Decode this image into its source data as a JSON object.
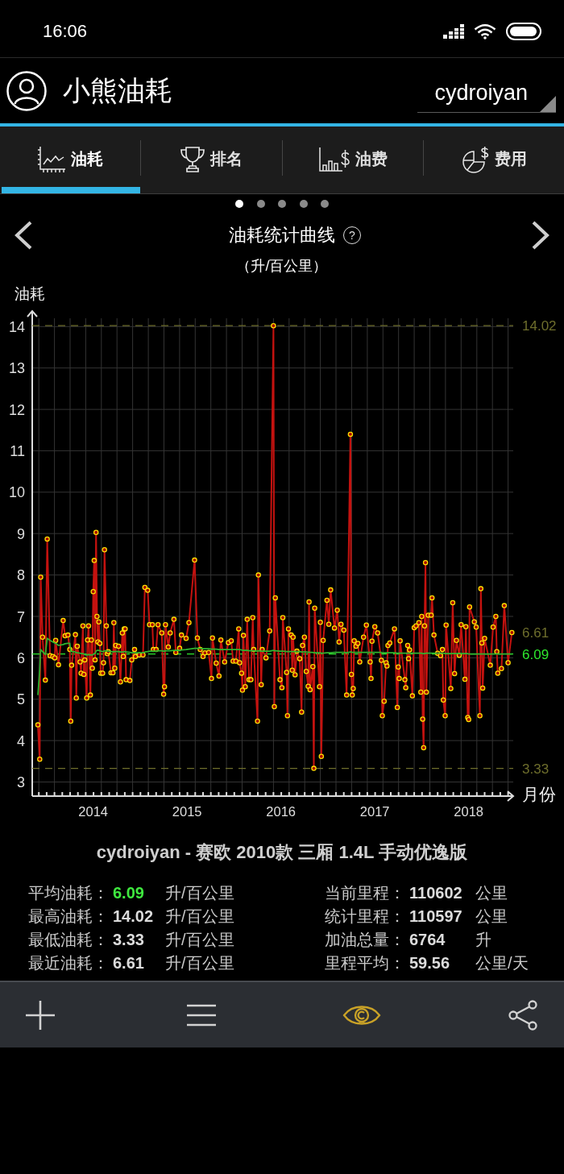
{
  "status_bar": {
    "time": "16:06"
  },
  "app_bar": {
    "title": "小熊油耗",
    "account": "cydroiyan"
  },
  "tabs": [
    {
      "label": "油耗",
      "selected": true
    },
    {
      "label": "排名",
      "selected": false
    },
    {
      "label": "油费",
      "selected": false
    },
    {
      "label": "费用",
      "selected": false
    }
  ],
  "page_dots": [
    {
      "selected": true
    },
    {
      "selected": false
    },
    {
      "selected": false
    },
    {
      "selected": false
    },
    {
      "selected": false
    }
  ],
  "chart_panel": {
    "title": "油耗统计曲线",
    "help": "?",
    "unit": "（升/百公里）",
    "chart_data": {
      "type": "line",
      "xlabel": "月份",
      "ylabel": "油耗",
      "grid": true,
      "xlim": [
        2013.35,
        2018.475
      ],
      "ylim": [
        2.66,
        14.2
      ],
      "xticks": [
        2014,
        2015,
        2016,
        2017,
        2018
      ],
      "yticks": [
        3,
        4,
        5,
        6,
        7,
        8,
        9,
        10,
        11,
        12,
        13,
        14
      ],
      "x": [
        2013.41,
        2013.43,
        2013.44,
        2013.46,
        2013.49,
        2013.51,
        2013.54,
        2013.57,
        2013.59,
        2013.6,
        2013.63,
        2013.68,
        2013.7,
        2013.73,
        2013.75,
        2013.76,
        2013.77,
        2013.81,
        2013.82,
        2013.83,
        2013.86,
        2013.87,
        2013.89,
        2013.9,
        2013.91,
        2013.93,
        2013.94,
        2013.95,
        2013.97,
        2013.98,
        2013.99,
        2014,
        2014.01,
        2014.02,
        2014.03,
        2014.04,
        2014.05,
        2014.06,
        2014.07,
        2014.08,
        2014.1,
        2014.11,
        2014.12,
        2014.14,
        2014.15,
        2014.16,
        2014.19,
        2014.21,
        2014.22,
        2014.23,
        2014.24,
        2014.27,
        2014.29,
        2014.31,
        2014.32,
        2014.33,
        2014.34,
        2014.35,
        2014.39,
        2014.41,
        2014.44,
        2014.45,
        2014.49,
        2014.53,
        2014.55,
        2014.58,
        2014.6,
        2014.63,
        2014.64,
        2014.67,
        2014.69,
        2014.73,
        2014.75,
        2014.76,
        2014.77,
        2014.8,
        2014.82,
        2014.86,
        2014.88,
        2014.92,
        2014.94,
        2014.99,
        2015.02,
        2015.08,
        2015.11,
        2015.14,
        2015.17,
        2015.19,
        2015.23,
        2015.26,
        2015.27,
        2015.31,
        2015.34,
        2015.36,
        2015.4,
        2015.44,
        2015.47,
        2015.49,
        2015.52,
        2015.55,
        2015.56,
        2015.58,
        2015.59,
        2015.6,
        2015.62,
        2015.64,
        2015.66,
        2015.68,
        2015.7,
        2015.71,
        2015.75,
        2015.76,
        2015.79,
        2015.8,
        2015.84,
        2015.88,
        2015.92,
        2015.93,
        2015.94,
        2015.99,
        2016.01,
        2016.02,
        2016.06,
        2016.07,
        2016.08,
        2016.11,
        2016.12,
        2016.13,
        2016.15,
        2016.17,
        2016.2,
        2016.22,
        2016.23,
        2016.25,
        2016.27,
        2016.29,
        2016.3,
        2016.31,
        2016.34,
        2016.35,
        2016.36,
        2016.41,
        2016.42,
        2016.43,
        2016.45,
        2016.49,
        2016.51,
        2016.53,
        2016.57,
        2016.6,
        2016.62,
        2016.64,
        2016.67,
        2016.7,
        2016.74,
        2016.75,
        2016.76,
        2016.77,
        2016.78,
        2016.8,
        2016.82,
        2016.84,
        2016.88,
        2016.91,
        2016.95,
        2016.96,
        2016.97,
        2017,
        2017.03,
        2017.07,
        2017.08,
        2017.1,
        2017.12,
        2017.13,
        2017.14,
        2017.16,
        2017.21,
        2017.24,
        2017.25,
        2017.26,
        2017.27,
        2017.32,
        2017.33,
        2017.35,
        2017.36,
        2017.37,
        2017.4,
        2017.42,
        2017.44,
        2017.47,
        2017.49,
        2017.5,
        2017.51,
        2017.52,
        2017.53,
        2017.54,
        2017.55,
        2017.57,
        2017.6,
        2017.61,
        2017.63,
        2017.67,
        2017.7,
        2017.72,
        2017.73,
        2017.75,
        2017.76,
        2017.81,
        2017.83,
        2017.85,
        2017.87,
        2017.9,
        2017.92,
        2017.96,
        2017.97,
        2017.99,
        2018,
        2018.01,
        2018.06,
        2018.08,
        2018.12,
        2018.13,
        2018.14,
        2018.15,
        2018.17,
        2018.23,
        2018.26,
        2018.29,
        2018.3,
        2018.31,
        2018.35,
        2018.38,
        2018.42,
        2018.46
      ],
      "series": [
        {
          "color": "#c4120f",
          "marker": "o",
          "values": [
            4.38,
            3.55,
            7.95,
            6.5,
            5.46,
            8.87,
            6.05,
            6.03,
            6.0,
            6.42,
            5.83,
            6.9,
            6.53,
            6.55,
            6.2,
            4.47,
            5.82,
            6.56,
            5.03,
            6.28,
            5.9,
            5.63,
            6.77,
            5.6,
            5.95,
            5.03,
            6.43,
            6.77,
            5.1,
            6.43,
            5.75,
            7.6,
            8.35,
            5.95,
            9.03,
            7.0,
            6.38,
            6.87,
            6.35,
            5.63,
            5.63,
            5.88,
            8.61,
            6.77,
            6.1,
            6.15,
            5.64,
            5.64,
            6.85,
            5.75,
            6.3,
            6.28,
            5.42,
            6.6,
            6.03,
            6.7,
            6.7,
            5.47,
            5.45,
            5.95,
            6.2,
            6.03,
            6.07,
            6.07,
            7.7,
            7.63,
            6.8,
            6.8,
            6.2,
            6.2,
            6.8,
            6.6,
            5.12,
            5.3,
            6.8,
            6.26,
            6.6,
            6.93,
            6.13,
            6.23,
            6.55,
            6.47,
            6.85,
            8.36,
            6.48,
            6.2,
            6.03,
            6.12,
            6.13,
            5.5,
            6.48,
            5.87,
            5.56,
            6.43,
            5.9,
            6.37,
            6.41,
            5.92,
            5.92,
            6.7,
            5.88,
            5.63,
            5.22,
            6.54,
            5.3,
            6.93,
            5.47,
            5.47,
            6.97,
            6.2,
            4.47,
            8.0,
            5.35,
            6.2,
            6.0,
            6.65,
            14.02,
            4.82,
            7.45,
            5.47,
            5.28,
            6.97,
            5.65,
            4.6,
            6.7,
            6.55,
            5.7,
            6.5,
            5.59,
            6.16,
            5.98,
            4.69,
            6.3,
            6.5,
            5.67,
            5.31,
            7.35,
            5.23,
            5.79,
            3.33,
            7.2,
            5.3,
            6.86,
            3.62,
            6.42,
            7.39,
            6.81,
            7.64,
            6.72,
            7.15,
            6.38,
            6.81,
            6.67,
            5.1,
            11.4,
            5.6,
            5.1,
            5.26,
            6.41,
            6.28,
            6.35,
            5.9,
            6.5,
            6.79,
            5.9,
            5.5,
            6.4,
            6.75,
            6.6,
            5.94,
            4.6,
            4.95,
            5.88,
            5.8,
            6.3,
            6.36,
            6.7,
            4.8,
            5.78,
            5.5,
            6.41,
            5.47,
            5.28,
            6.3,
            5.98,
            6.19,
            5.08,
            6.73,
            6.77,
            6.85,
            5.17,
            7.0,
            4.52,
            3.83,
            6.77,
            8.3,
            5.17,
            7.03,
            7.03,
            7.45,
            6.55,
            6.11,
            6.05,
            6.2,
            4.98,
            4.6,
            6.79,
            5.26,
            7.33,
            5.62,
            6.42,
            6.06,
            6.8,
            5.48,
            6.75,
            4.56,
            4.51,
            7.23,
            6.87,
            6.74,
            4.6,
            7.67,
            6.36,
            5.27,
            6.47,
            5.82,
            6.74,
            7.0,
            6.15,
            5.63,
            5.74,
            7.26,
            5.88,
            6.61
          ]
        },
        {
          "color": "#2fb52f",
          "values": [
            5.1,
            5.7,
            6.2,
            6.15,
            6.08,
            6.47,
            6.42,
            6.38,
            6.36,
            6.35,
            6.3,
            6.32,
            6.34,
            6.35,
            6.35,
            6.15,
            6.15,
            6.14,
            6.12,
            6.12,
            6.11,
            6.1,
            6.1,
            6.09,
            6.08,
            6.07,
            6.07,
            6.08,
            6.07,
            6.07,
            6.07,
            6.08,
            6.1,
            6.1,
            6.16,
            6.18,
            6.18,
            6.18,
            6.17,
            6.16,
            6.15,
            6.15,
            6.17,
            6.17,
            6.16,
            6.16,
            6.15,
            6.14,
            6.15,
            6.15,
            6.15,
            6.15,
            6.14,
            6.14,
            6.14,
            6.15,
            6.15,
            6.14,
            6.13,
            6.12,
            6.12,
            6.12,
            6.12,
            6.12,
            6.14,
            6.15,
            6.16,
            6.16,
            6.16,
            6.16,
            6.17,
            6.17,
            6.16,
            6.16,
            6.17,
            6.17,
            6.17,
            6.18,
            6.18,
            6.18,
            6.19,
            6.2,
            6.21,
            6.23,
            6.23,
            6.23,
            6.22,
            6.22,
            6.22,
            6.21,
            6.21,
            6.21,
            6.2,
            6.2,
            6.2,
            6.2,
            6.2,
            6.2,
            6.2,
            6.2,
            6.2,
            6.19,
            6.18,
            6.18,
            6.18,
            6.18,
            6.17,
            6.17,
            6.17,
            6.17,
            6.16,
            6.17,
            6.16,
            6.16,
            6.16,
            6.16,
            6.18,
            6.17,
            6.17,
            6.16,
            6.16,
            6.16,
            6.15,
            6.15,
            6.15,
            6.15,
            6.15,
            6.15,
            6.15,
            6.15,
            6.15,
            6.14,
            6.14,
            6.14,
            6.14,
            6.13,
            6.14,
            6.13,
            6.13,
            6.12,
            6.12,
            6.12,
            6.12,
            6.11,
            6.11,
            6.12,
            6.12,
            6.12,
            6.13,
            6.13,
            6.13,
            6.13,
            6.13,
            6.12,
            6.14,
            6.14,
            6.13,
            6.13,
            6.13,
            6.13,
            6.13,
            6.13,
            6.13,
            6.13,
            6.13,
            6.13,
            6.13,
            6.13,
            6.13,
            6.13,
            6.12,
            6.12,
            6.12,
            6.12,
            6.12,
            6.12,
            6.12,
            6.11,
            6.11,
            6.11,
            6.11,
            6.11,
            6.11,
            6.11,
            6.11,
            6.11,
            6.11,
            6.11,
            6.11,
            6.11,
            6.11,
            6.11,
            6.1,
            6.1,
            6.1,
            6.11,
            6.11,
            6.11,
            6.11,
            6.11,
            6.11,
            6.11,
            6.11,
            6.11,
            6.11,
            6.1,
            6.1,
            6.1,
            6.1,
            6.1,
            6.1,
            6.1,
            6.1,
            6.1,
            6.1,
            6.1,
            6.09,
            6.09,
            6.09,
            6.09,
            6.09,
            6.09,
            6.09,
            6.09,
            6.09,
            6.09,
            6.09,
            6.09,
            6.09,
            6.09,
            6.09,
            6.09,
            6.09,
            6.09
          ]
        }
      ],
      "ref_lines": [
        {
          "axis": "y",
          "value": 14.02,
          "label": "14.02",
          "color": "#6e6e2c"
        },
        {
          "axis": "y",
          "value": 6.09,
          "label": "6.09",
          "color": "#2ee82e"
        },
        {
          "axis": "y",
          "value": 3.33,
          "label": "3.33",
          "color": "#6e6e2c"
        }
      ],
      "annotations": [
        "6.61"
      ]
    }
  },
  "vehicle": "cydroiyan - 赛欧 2010款 三厢 1.4L 手动优逸版",
  "stats": {
    "left": [
      {
        "label": "平均油耗：",
        "value": "6.09",
        "unit": "升/百公里",
        "highlight": true
      },
      {
        "label": "最高油耗：",
        "value": "14.02",
        "unit": "升/百公里",
        "highlight": false
      },
      {
        "label": "最低油耗：",
        "value": "3.33",
        "unit": "升/百公里",
        "highlight": false
      },
      {
        "label": "最近油耗：",
        "value": "6.61",
        "unit": "升/百公里",
        "highlight": false
      }
    ],
    "right": [
      {
        "label": "当前里程：",
        "value": "110602",
        "unit": "公里",
        "highlight": false
      },
      {
        "label": "统计里程：",
        "value": "110597",
        "unit": "公里",
        "highlight": false
      },
      {
        "label": "加油总量：",
        "value": "6764",
        "unit": "升",
        "highlight": false
      },
      {
        "label": "里程平均：",
        "value": "59.56",
        "unit": "公里/天",
        "highlight": false
      }
    ]
  },
  "toolbar": [
    {
      "selected": false
    },
    {
      "selected": false
    },
    {
      "selected": true
    },
    {
      "selected": false
    }
  ]
}
